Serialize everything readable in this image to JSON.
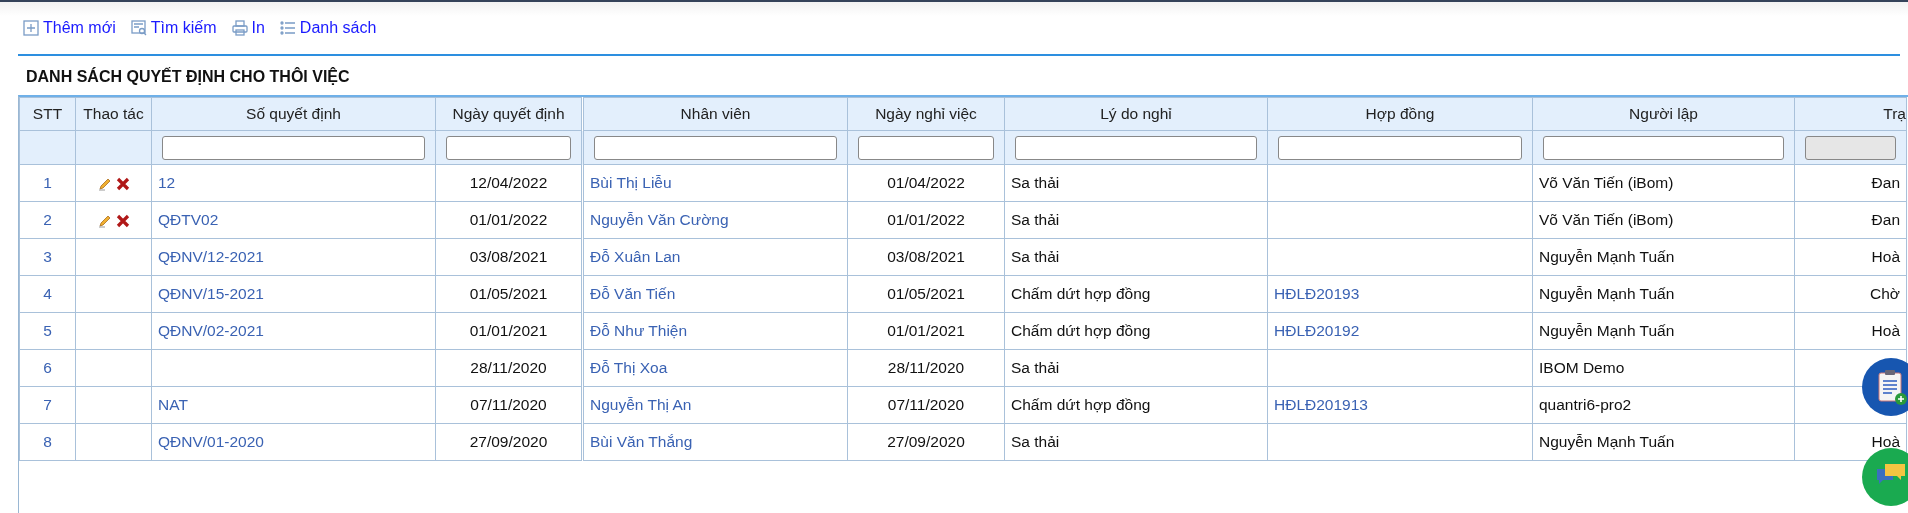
{
  "toolbar": [
    {
      "kind": "add",
      "label": "Thêm mới"
    },
    {
      "kind": "search",
      "label": "Tìm kiếm"
    },
    {
      "kind": "print",
      "label": "In"
    },
    {
      "kind": "list",
      "label": "Danh sách"
    }
  ],
  "title": "DANH SÁCH QUYẾT ĐỊNH CHO THÔI VIỆC",
  "table": {
    "columns": [
      {
        "label": "STT",
        "filter": false
      },
      {
        "label": "Thao tác",
        "filter": false
      },
      {
        "label": "Số quyết định",
        "filter": true,
        "disabled": false
      },
      {
        "label": "Ngày quyết định",
        "filter": true,
        "disabled": false
      },
      {
        "label": "Nhân viên",
        "filter": true,
        "disabled": false
      },
      {
        "label": "Ngày nghỉ việc",
        "filter": true,
        "disabled": false
      },
      {
        "label": "Lý do nghỉ",
        "filter": true,
        "disabled": false
      },
      {
        "label": "Hợp đồng",
        "filter": true,
        "disabled": false
      },
      {
        "label": "Người lập",
        "filter": true,
        "disabled": false
      },
      {
        "label": "Trạ",
        "filter": true,
        "disabled": true
      }
    ],
    "rows": [
      {
        "stt": "1",
        "editable": true,
        "decision_no": "12",
        "decision_date": "12/04/2022",
        "employee": "Bùi Thị Liễu",
        "leave_date": "01/04/2022",
        "reason": "Sa thải",
        "creator": "Võ Văn Tiến (iBom)",
        "status": "Đan"
      },
      {
        "stt": "2",
        "editable": true,
        "decision_no": "QĐTV02",
        "decision_date": "01/01/2022",
        "employee": "Nguyễn Văn Cường",
        "leave_date": "01/01/2022",
        "reason": "Sa thải",
        "creator": "Võ Văn Tiến (iBom)",
        "status": "Đan"
      },
      {
        "stt": "3",
        "editable": false,
        "decision_no": "QĐNV/12-2021",
        "decision_date": "03/08/2021",
        "employee": "Đỗ Xuân Lan",
        "leave_date": "03/08/2021",
        "reason": "Sa thải",
        "creator": "Nguyễn Mạnh Tuấn",
        "status": "Hoà"
      },
      {
        "stt": "4",
        "editable": false,
        "decision_no": "QĐNV/15-2021",
        "decision_date": "01/05/2021",
        "employee": "Đỗ Văn Tiến",
        "leave_date": "01/05/2021",
        "reason": "Chấm dứt hợp đồng",
        "contract": "HĐLĐ20193",
        "creator": "Nguyễn Mạnh Tuấn",
        "status": "Chờ"
      },
      {
        "stt": "5",
        "editable": false,
        "decision_no": "QĐNV/02-2021",
        "decision_date": "01/01/2021",
        "employee": "Đỗ Như Thiện",
        "leave_date": "01/01/2021",
        "reason": "Chấm dứt hợp đồng",
        "contract": "HĐLĐ20192",
        "creator": "Nguyễn Mạnh Tuấn",
        "status": "Hoà"
      },
      {
        "stt": "6",
        "editable": false,
        "decision_date": "28/11/2020",
        "employee": "Đỗ Thị Xoa",
        "leave_date": "28/11/2020",
        "reason": "Sa thải",
        "creator": "IBOM Demo"
      },
      {
        "stt": "7",
        "editable": false,
        "decision_no": "NAT",
        "decision_date": "07/11/2020",
        "employee": "Nguyễn Thị An",
        "leave_date": "07/11/2020",
        "reason": "Chấm dứt hợp đồng",
        "contract": "HĐLĐ201913",
        "creator": "quantri6-pro2"
      },
      {
        "stt": "8",
        "editable": false,
        "decision_no": "QĐNV/01-2020",
        "decision_date": "27/09/2020",
        "employee": "Bùi Văn Thắng",
        "leave_date": "27/09/2020",
        "reason": "Sa thải",
        "creator": "Nguyễn Mạnh Tuấn",
        "status": "Hoà"
      }
    ]
  }
}
